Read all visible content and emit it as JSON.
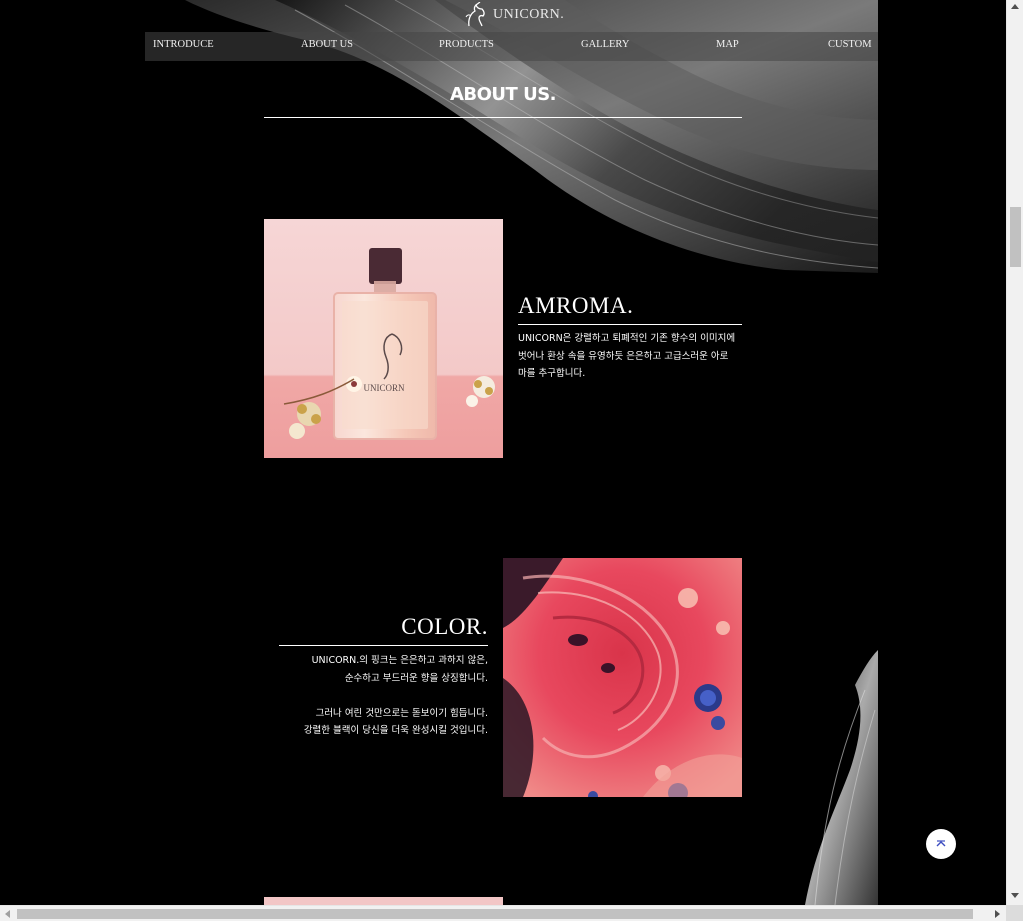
{
  "brand": {
    "name": "UNICORN.",
    "logo_icon": "unicorn-head-icon"
  },
  "nav": {
    "items": [
      {
        "label": "INTRODUCE"
      },
      {
        "label": "ABOUT US"
      },
      {
        "label": "PRODUCTS"
      },
      {
        "label": "GALLERY"
      },
      {
        "label": "MAP"
      },
      {
        "label": "CUSTOM"
      }
    ]
  },
  "about": {
    "title": "ABOUT US."
  },
  "sections": [
    {
      "title": "AMROMA.",
      "lines": [
        "UNICORN은 강렬하고 퇴폐적인 기존 향수의 이미지에",
        "벗어나 환상 속을 유영하듯 은은하고 고급스러운 아로",
        "마를 추구합니다."
      ],
      "image": "perfume-bottle-photo"
    },
    {
      "title": "COLOR.",
      "lines": [
        "UNICORN.의 핑크는 은은하고 과하지 않은,",
        "순수하고 부드러운 향을 상징합니다.",
        "",
        "그러나 여린 것만으로는 돋보이기 힘듭니다.",
        "강렬한 블랙이 당신을 더욱 완성시킬 것입니다."
      ],
      "image": "pink-fluid-art-photo"
    }
  ],
  "scroll_top": {
    "icon": "chevron-up-icon"
  },
  "colors": {
    "background": "#000000",
    "text": "#ffffff",
    "pink": "#f2c6c6",
    "coral": "#e8485e"
  }
}
